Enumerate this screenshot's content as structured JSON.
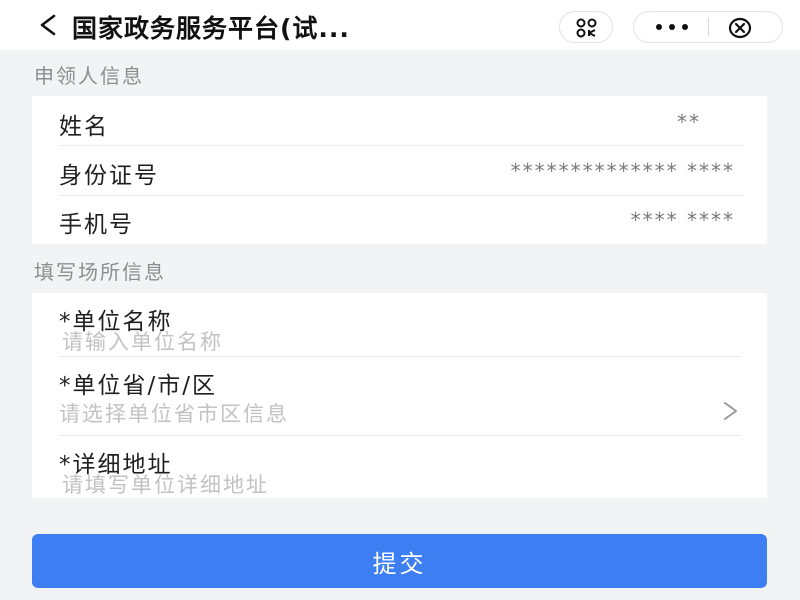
{
  "navbar": {
    "title": "国家政务服务平台(试...",
    "icons": [
      "chevron-left-icon",
      "scan-icon",
      "more-icon",
      "close-icon"
    ]
  },
  "applicant": {
    "section_title": "申领人信息",
    "rows": [
      {
        "label": "姓名",
        "value": "**"
      },
      {
        "label": "身份证号",
        "value": "************** ****"
      },
      {
        "label": "手机号",
        "value": "**** ****"
      }
    ]
  },
  "venue": {
    "section_title": "填写场所信息",
    "unit_name": {
      "label": "*单位名称",
      "placeholder": "请输入单位名称"
    },
    "unit_region": {
      "label": "*单位省/市/区",
      "placeholder": "请选择单位省市区信息"
    },
    "address": {
      "label": "*详细地址",
      "placeholder": "请填写单位详细地址"
    }
  },
  "submit": {
    "label": "提交"
  },
  "colors": {
    "primary": "#3d7ff2",
    "background": "#f2f3f5"
  }
}
